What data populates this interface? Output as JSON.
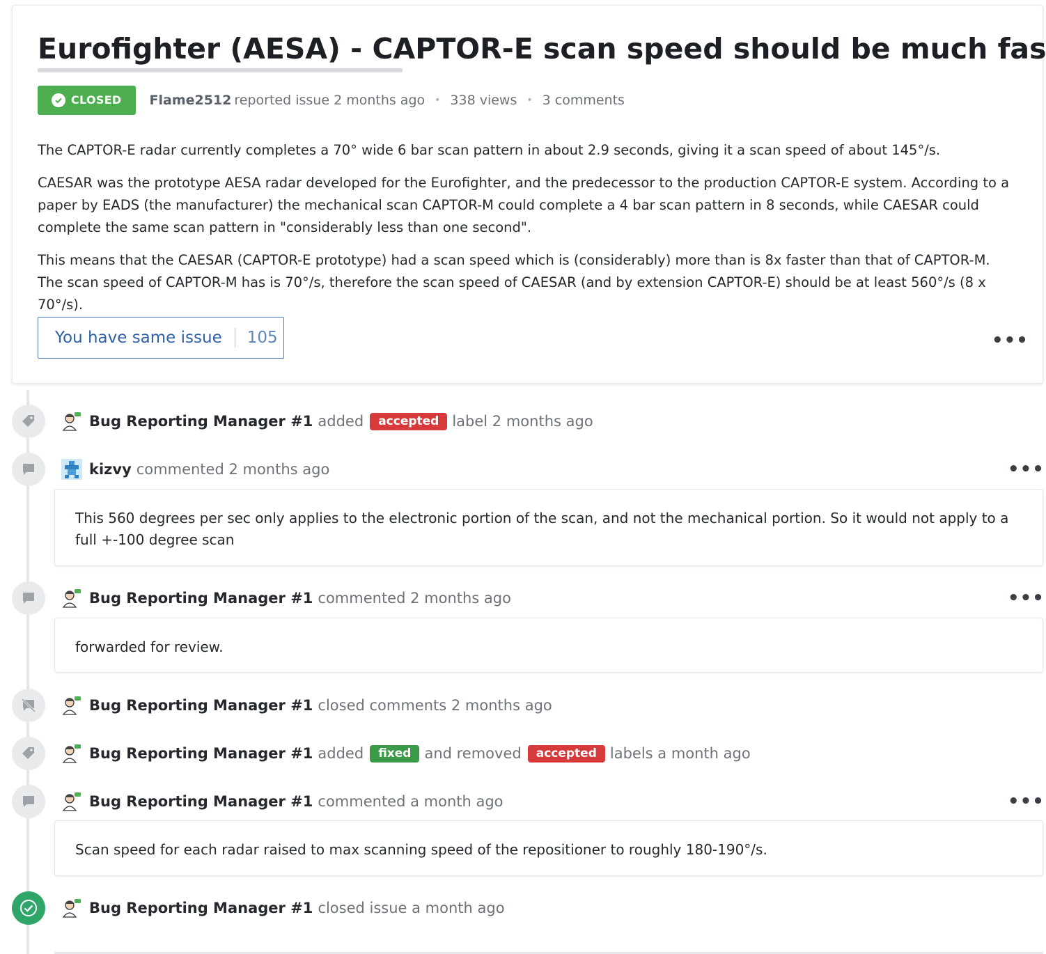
{
  "issue": {
    "title": "Eurofighter (AESA) - CAPTOR-E scan speed should be much faster",
    "status": "CLOSED",
    "author": "Flame2512",
    "reported_text": "reported issue 2 months ago",
    "views": "338 views",
    "comments_count": "3 comments",
    "body": [
      "The CAPTOR-E radar currently completes a 70° wide 6 bar scan pattern in about 2.9 seconds, giving it a scan speed of about 145°/s.",
      "CAESAR was the prototype AESA radar developed for the Eurofighter, and the predecessor to the production CAPTOR-E system. According to a paper by EADS (the manufacturer) the mechanical scan CAPTOR-M could complete a 4 bar scan pattern in 8 seconds, while CAESAR could complete the same scan pattern in \"considerably less than one second\".",
      "This means that the CAESAR (CAPTOR-E prototype) had a scan speed which is (considerably) more than is 8x faster than that of CAPTOR-M. The scan speed of CAPTOR-M has is 70°/s, therefore the scan speed of CAESAR (and by extension CAPTOR-E) should be at least 560°/s (8 x 70°/s)."
    ],
    "same_issue_label": "You have same issue",
    "same_issue_count": "105",
    "more": "•••"
  },
  "timeline": {
    "e1": {
      "user": "Bug Reporting Manager #1",
      "added": "added",
      "label": "accepted",
      "suffix": "label 2 months ago"
    },
    "e2": {
      "user": "kizvy",
      "action": "commented 2 months ago",
      "body": "This 560 degrees per sec only applies to the electronic portion of the scan, and not the mechanical portion. So it would not apply to a full +-100 degree scan",
      "more": "•••"
    },
    "e3": {
      "user": "Bug Reporting Manager #1",
      "action": "commented 2 months ago",
      "body": "forwarded for review.",
      "more": "•••"
    },
    "e4": {
      "user": "Bug Reporting Manager #1",
      "action": "closed comments 2 months ago"
    },
    "e5": {
      "user": "Bug Reporting Manager #1",
      "added": "added",
      "label_added": "fixed",
      "removed": "and removed",
      "label_removed": "accepted",
      "suffix": "labels a month ago"
    },
    "e6": {
      "user": "Bug Reporting Manager #1",
      "action": "commented a month ago",
      "body": "Scan speed for each radar raised to max scanning speed of the repositioner to roughly 180-190°/s.",
      "more": "•••"
    },
    "e7": {
      "user": "Bug Reporting Manager #1",
      "action": "closed issue a month ago"
    }
  },
  "colors": {
    "closed": "#4cae4f",
    "label_red": "#d73a3a",
    "label_green": "#3b9a48",
    "link": "#2f5fa5"
  },
  "icons": [
    "check-circle-icon",
    "tag-icon",
    "comment-icon",
    "comment-off-icon",
    "check-icon",
    "avatar-icon",
    "more-icon"
  ]
}
